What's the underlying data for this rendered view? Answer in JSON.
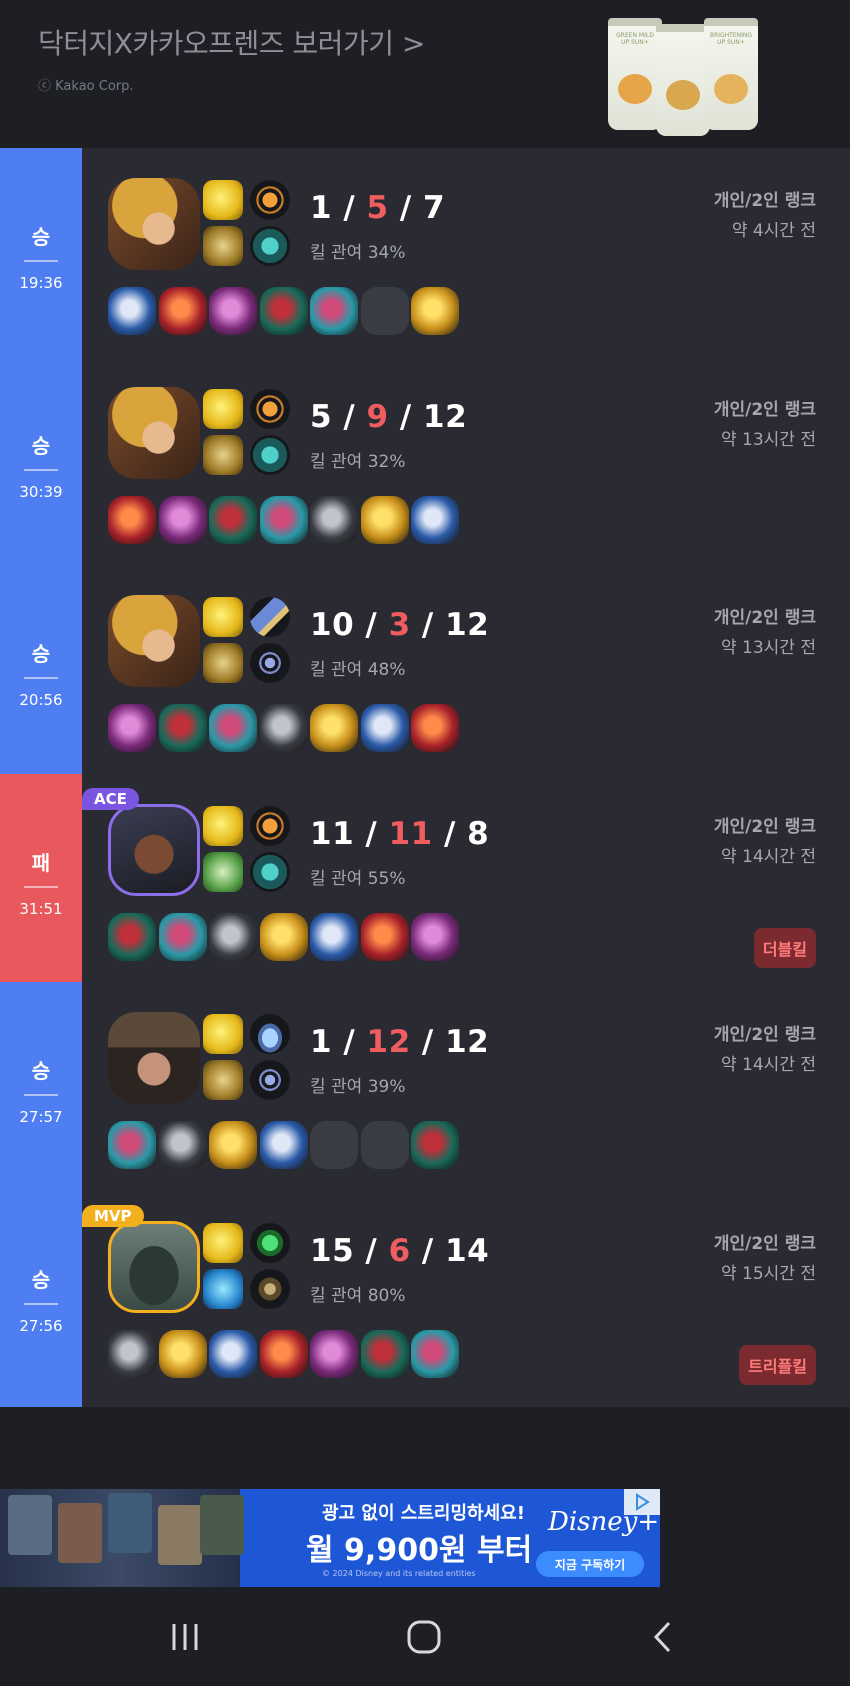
{
  "banner": {
    "title": "닥터지X카카오프렌즈 보러가기 >",
    "copyright": "ⓒ Kakao Corp.",
    "product_labels": [
      "GREEN MILD UP SUN+",
      "",
      "BRIGHTENING UP SUN+"
    ]
  },
  "matches": [
    {
      "result": "승",
      "result_type": "win",
      "duration": "19:36",
      "champion_icon": "ezreal-portrait",
      "badge": "",
      "spells": [
        "flash-spell",
        "ghost-spell"
      ],
      "runes": [
        "conqueror-rune",
        "sorcery-rune"
      ],
      "kills": "1",
      "deaths": "5",
      "assists": "7",
      "kill_participation": "킬 관여 34%",
      "queue": "개인/2인 랭크",
      "time_ago": "약 4시간 전",
      "multikill": "",
      "items": [
        "item-1",
        "item-2",
        "item-3",
        "item-4",
        "item-5",
        "empty",
        "trinket"
      ]
    },
    {
      "result": "승",
      "result_type": "win",
      "duration": "30:39",
      "champion_icon": "ezreal-portrait",
      "badge": "",
      "spells": [
        "flash-spell",
        "ghost-spell"
      ],
      "runes": [
        "conqueror-rune",
        "sorcery-rune"
      ],
      "kills": "5",
      "deaths": "9",
      "assists": "12",
      "kill_participation": "킬 관여 32%",
      "queue": "개인/2인 랭크",
      "time_ago": "약 13시간 전",
      "multikill": "",
      "items": [
        "item-1",
        "item-2",
        "item-3",
        "item-4",
        "item-5",
        "item-6",
        "trinket"
      ]
    },
    {
      "result": "승",
      "result_type": "win",
      "duration": "20:56",
      "champion_icon": "ezreal-portrait",
      "badge": "",
      "spells": [
        "flash-spell",
        "ghost-spell"
      ],
      "runes": [
        "press-attack-rune",
        "inspiration-rune"
      ],
      "kills": "10",
      "deaths": "3",
      "assists": "12",
      "kill_participation": "킬 관여 48%",
      "queue": "개인/2인 랭크",
      "time_ago": "약 13시간 전",
      "multikill": "",
      "items": [
        "item-1",
        "item-2",
        "item-3",
        "item-4",
        "item-5",
        "item-6",
        "trinket"
      ]
    },
    {
      "result": "패",
      "result_type": "loss",
      "duration": "31:51",
      "champion_icon": "lucian-portrait",
      "badge": "ACE",
      "spells": [
        "flash-spell",
        "heal-spell"
      ],
      "runes": [
        "conqueror-rune",
        "sorcery-rune"
      ],
      "kills": "11",
      "deaths": "11",
      "assists": "8",
      "kill_participation": "킬 관여 55%",
      "queue": "개인/2인 랭크",
      "time_ago": "약 14시간 전",
      "multikill": "더블킬",
      "items": [
        "item-1",
        "item-2",
        "item-3",
        "item-4",
        "item-5",
        "item-6",
        "trinket"
      ]
    },
    {
      "result": "승",
      "result_type": "win",
      "duration": "27:57",
      "champion_icon": "twisted-fate-portrait",
      "badge": "",
      "spells": [
        "flash-spell",
        "ghost-spell"
      ],
      "runes": [
        "first-strike-rune",
        "inspiration-rune"
      ],
      "kills": "1",
      "deaths": "12",
      "assists": "12",
      "kill_participation": "킬 관여 39%",
      "queue": "개인/2인 랭크",
      "time_ago": "약 14시간 전",
      "multikill": "",
      "items": [
        "item-1",
        "item-2",
        "item-3",
        "item-4",
        "empty",
        "empty",
        "trinket"
      ]
    },
    {
      "result": "승",
      "result_type": "win",
      "duration": "27:56",
      "champion_icon": "tahm-kench-portrait",
      "badge": "MVP",
      "spells": [
        "flash-spell",
        "cleanse-spell"
      ],
      "runes": [
        "resolve-rune",
        "domination-rune"
      ],
      "kills": "15",
      "deaths": "6",
      "assists": "14",
      "kill_participation": "킬 관여 80%",
      "queue": "개인/2인 랭크",
      "time_ago": "약 15시간 전",
      "multikill": "트리플킬",
      "items": [
        "item-1",
        "item-2",
        "item-3",
        "item-4",
        "item-5",
        "item-6",
        "trinket"
      ]
    }
  ],
  "ad": {
    "line1": "광고 없이 스트리밍하세요!",
    "line2": "월 9,900원 부터",
    "fine_print": "© 2024 Disney and its related entities",
    "logo": "Disney+",
    "cta": "지금 구독하기"
  },
  "colors": {
    "win": "#4f7df2",
    "loss": "#e9585c",
    "deaths": "#ef5d60",
    "ace": "#7a55e0",
    "mvp": "#f2b01e"
  }
}
